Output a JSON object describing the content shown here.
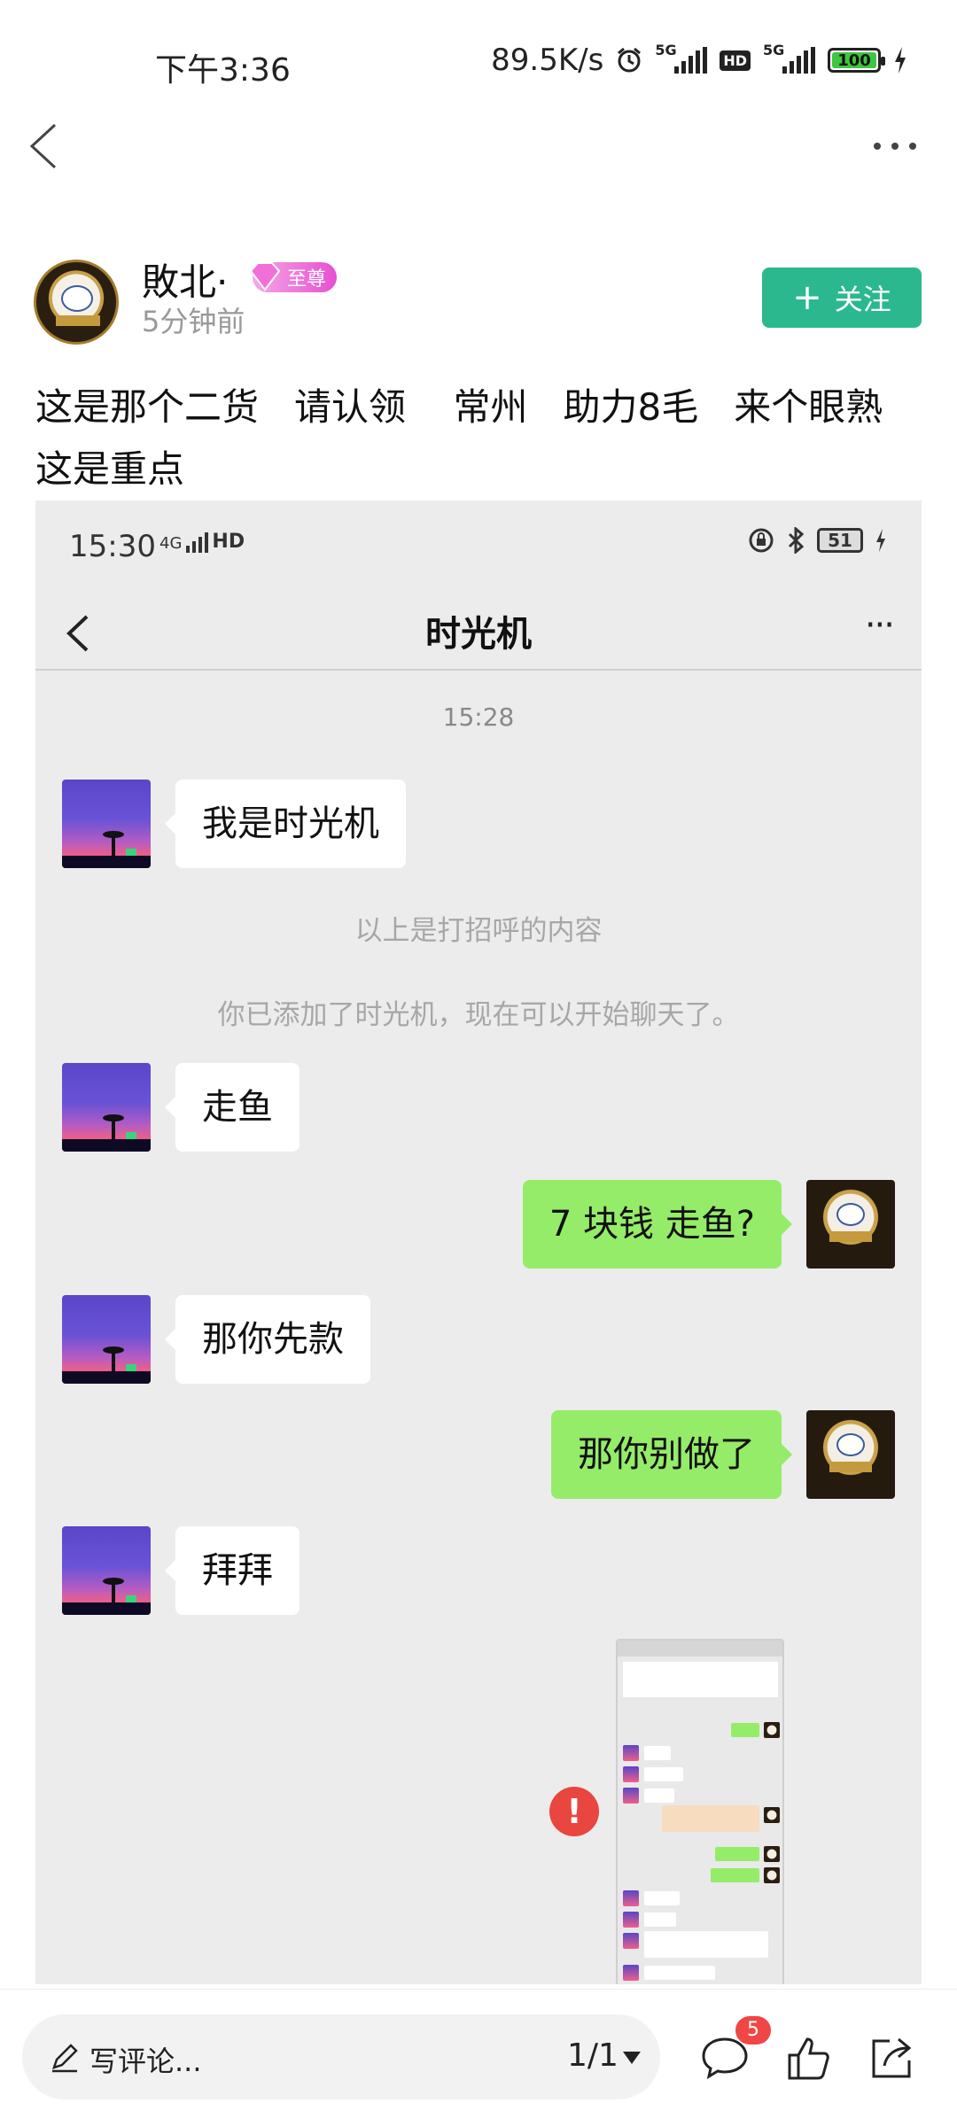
{
  "status_bar": {
    "time": "下午3:36",
    "net_speed": "89.5K/s",
    "net1": "5G",
    "hd": "HD",
    "net2": "5G",
    "battery": "100"
  },
  "author": {
    "name": "敗北·",
    "vip_label": "至尊",
    "time": "5分钟前",
    "follow_label": "关注",
    "follow_plus": "+"
  },
  "post": {
    "line1": "这是那个二货   请认领    常州   助力8毛   来个眼熟",
    "line2": "这是重点"
  },
  "screenshot": {
    "time": "15:30",
    "signal": "4G",
    "hd": "HD",
    "battery": "51",
    "title": "时光机",
    "more": "···",
    "chat_time": "15:28",
    "note1": "以上是打招呼的内容",
    "note2": "你已添加了时光机，现在可以开始聊天了。",
    "messages": [
      {
        "side": "left",
        "text": "我是时光机"
      },
      {
        "side": "left",
        "text": "走鱼"
      },
      {
        "side": "right",
        "text": "7 块钱  走鱼?"
      },
      {
        "side": "left",
        "text": "那你先款"
      },
      {
        "side": "right",
        "text": "那你别做了"
      },
      {
        "side": "left",
        "text": "拜拜"
      }
    ],
    "error_mark": "!"
  },
  "bottom_bar": {
    "comment_placeholder": "写评论...",
    "page_indicator": "1/1",
    "comment_count": "5"
  },
  "colors": {
    "follow": "#2bb88f",
    "bubble_right": "#95ec69",
    "badge": "#f04646",
    "error": "#e9463f"
  }
}
